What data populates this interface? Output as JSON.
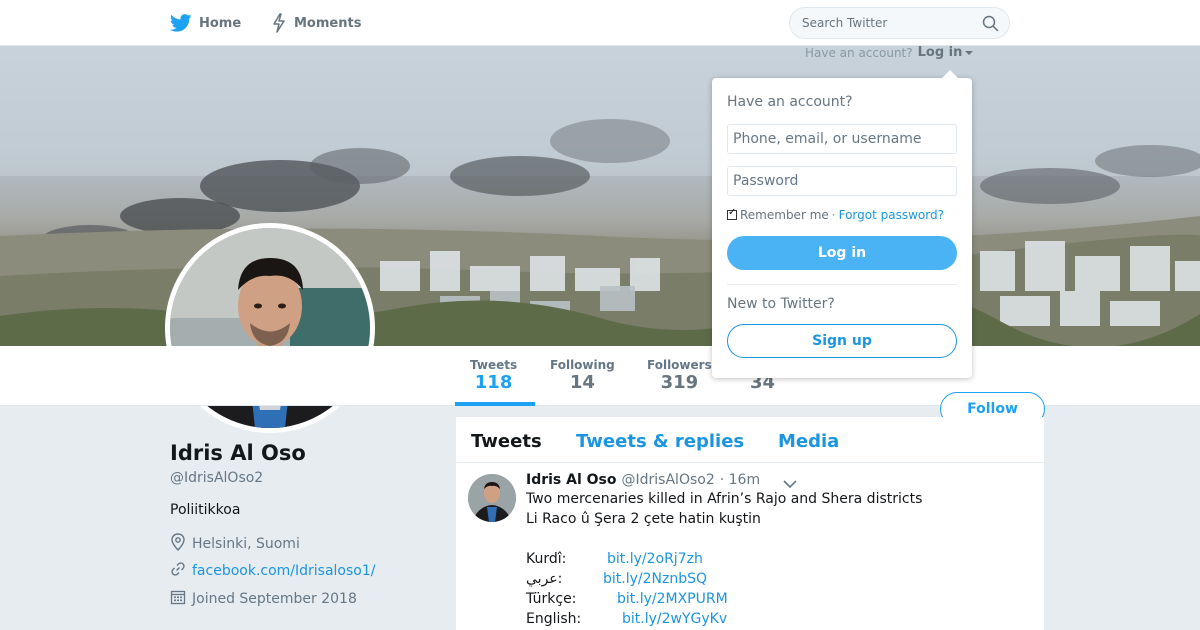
{
  "nav": {
    "home_label": "Home",
    "moments_label": "Moments",
    "search_placeholder": "Search Twitter"
  },
  "account_prompt": {
    "text": "Have an account?",
    "login_label": "Log in"
  },
  "login_dropdown": {
    "title": "Have an account?",
    "username_placeholder": "Phone, email, or username",
    "password_placeholder": "Password",
    "remember_label": "Remember me",
    "separator": "·",
    "forgot_label": "Forgot password?",
    "login_button": "Log in",
    "new_prompt": "New to Twitter?",
    "signup_button": "Sign up"
  },
  "stats": [
    {
      "label": "Tweets",
      "value": "118"
    },
    {
      "label": "Following",
      "value": "14"
    },
    {
      "label": "Followers",
      "value": "319"
    },
    {
      "label": "",
      "value": "34"
    }
  ],
  "follow_button": "Follow",
  "profile": {
    "name": "Idris Al Oso",
    "handle": "@IdrisAlOso2",
    "bio": "Poliitikkoa",
    "location": "Helsinki, Suomi",
    "website": "facebook.com/Idrisaloso1/",
    "joined": "Joined September 2018"
  },
  "tabs": [
    "Tweets",
    "Tweets & replies",
    "Media"
  ],
  "tweet": {
    "name": "Idris Al Oso",
    "handle": "@IdrisAlOso2",
    "time": "· 16m",
    "line1": "Two mercenaries killed in Afrin’s Rajo and Shera districts",
    "line2": "Li Raco û Şera 2 çete hatin kuştin",
    "links": [
      {
        "lang": "Kurdî:",
        "url": "bit.ly/2oRj7zh"
      },
      {
        "lang": "عربي:",
        "url": "bit.ly/2NznbSQ"
      },
      {
        "lang": "Türkçe:",
        "url": "bit.ly/2MXPURM"
      },
      {
        "lang": "English:",
        "url": "bit.ly/2wYGyKv"
      }
    ]
  },
  "colors": {
    "brand": "#1da1f2",
    "link": "#1b95e0",
    "login_button": "#4ab3f4"
  }
}
